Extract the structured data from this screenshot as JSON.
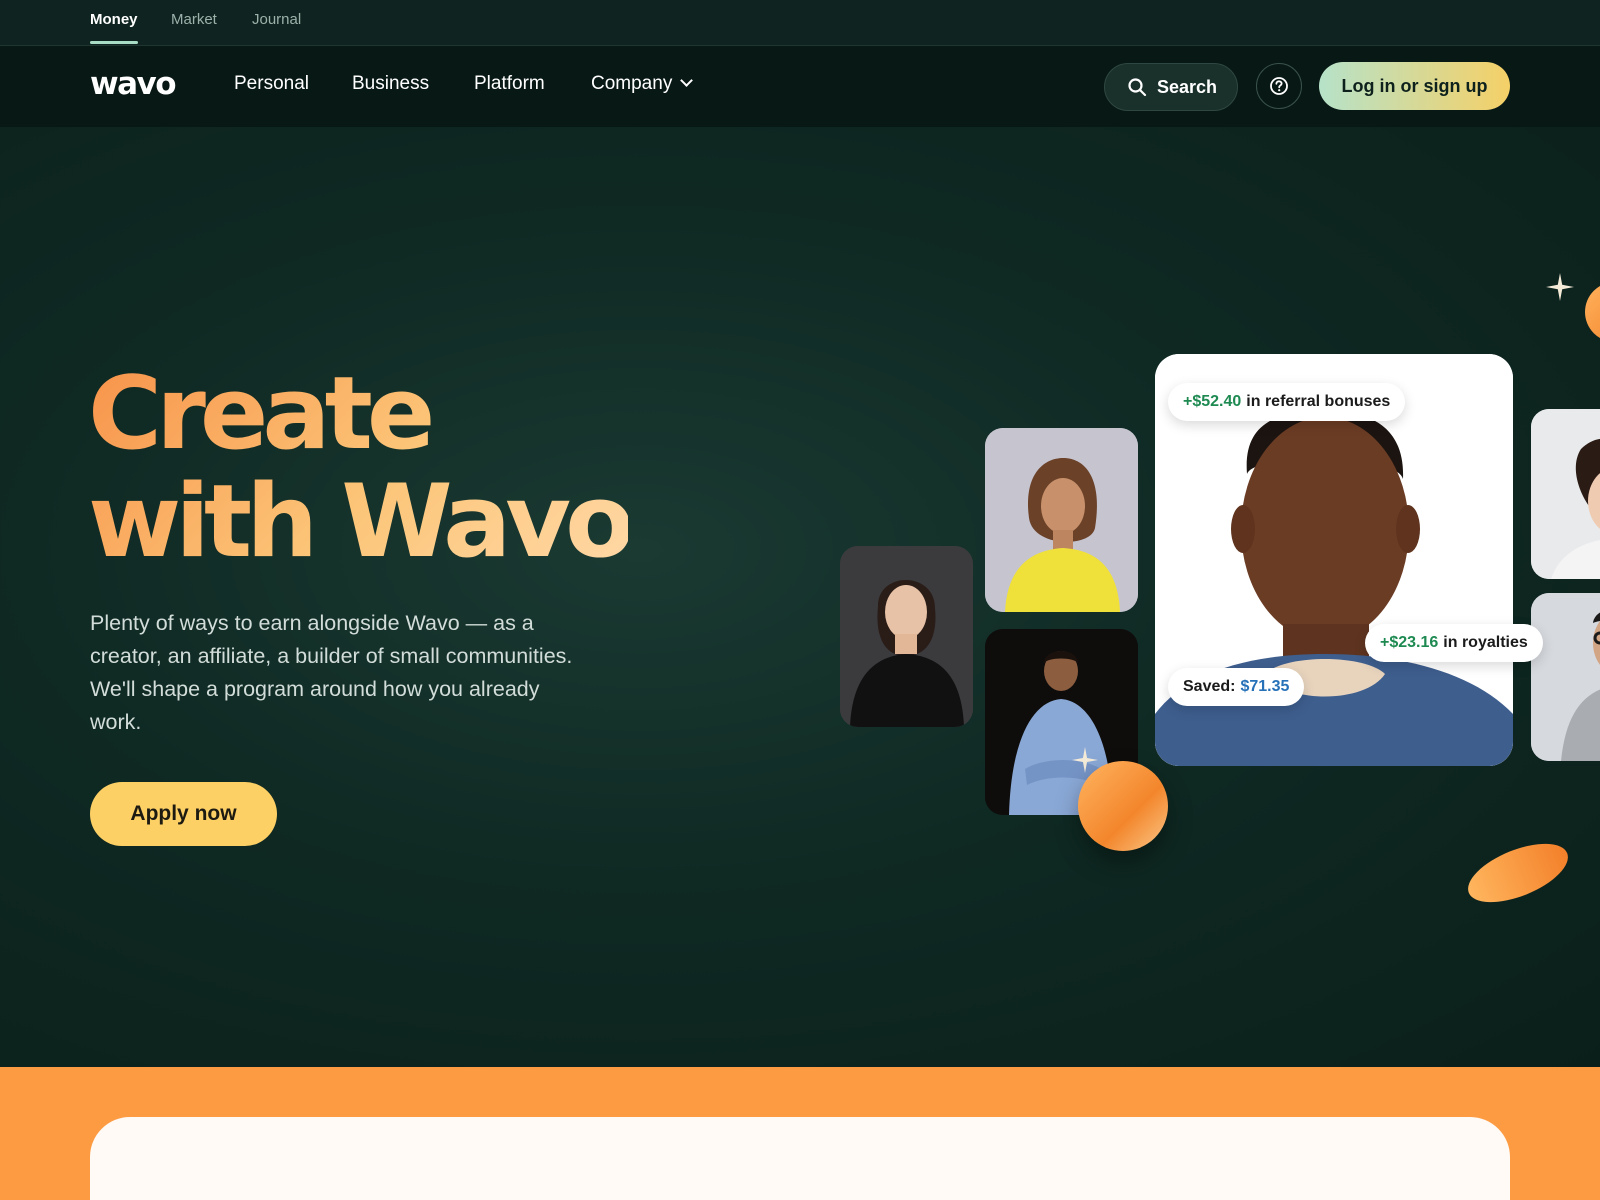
{
  "top_tabs": [
    {
      "label": "Money",
      "active": true
    },
    {
      "label": "Market",
      "active": false
    },
    {
      "label": "Journal",
      "active": false
    }
  ],
  "nav": {
    "logo": "wavo",
    "links": [
      "Personal",
      "Business",
      "Platform",
      "Company"
    ],
    "search_label": "Search",
    "login_label": "Log in or sign up",
    "icons": {
      "search": "search-icon",
      "help": "help-circle-icon",
      "dropdown": "chevron-down-icon"
    }
  },
  "hero": {
    "title_line1": "Create",
    "title_line2": "with Wavo",
    "subtitle": "Plenty of ways to earn alongside Wavo — as a creator, an affiliate, a builder of small communities. We'll shape a program around how you already work.",
    "cta_label": "Apply now"
  },
  "badges": {
    "referral": {
      "amount": "+$52.40",
      "text": "in referral bonuses"
    },
    "royalties": {
      "amount": "+$23.16",
      "text": "in royalties"
    },
    "saved": {
      "label": "Saved:",
      "amount": "$71.35"
    }
  },
  "colors": {
    "background": "#0d211c",
    "accent_orange": "#fd9b43",
    "cta_yellow": "#fdd065",
    "mint": "#b6e2c9",
    "gain_green": "#1e8a52",
    "saved_blue": "#2771b8"
  }
}
